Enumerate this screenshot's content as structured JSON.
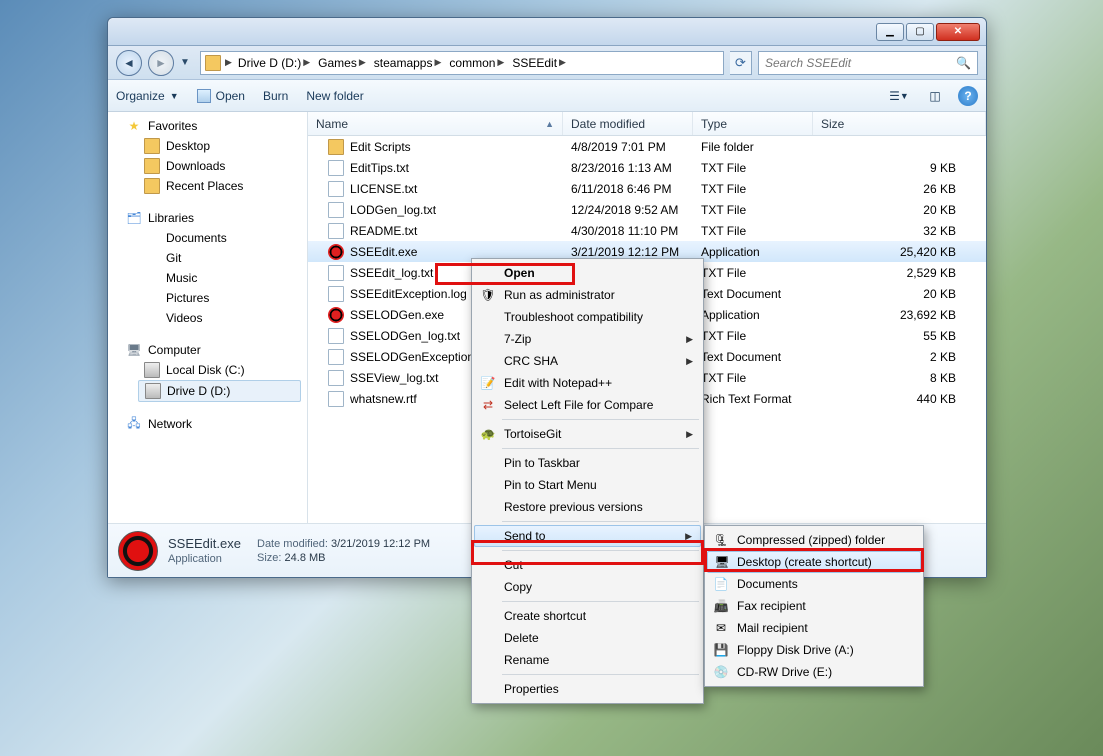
{
  "address": {
    "segments": [
      "Drive D (D:)",
      "Games",
      "steamapps",
      "common",
      "SSEEdit"
    ]
  },
  "search": {
    "placeholder": "Search SSEEdit"
  },
  "toolbar": {
    "organize": "Organize",
    "open": "Open",
    "burn": "Burn",
    "newfolder": "New folder"
  },
  "columns": {
    "name": "Name",
    "date": "Date modified",
    "type": "Type",
    "size": "Size"
  },
  "nav": {
    "favorites": {
      "label": "Favorites",
      "items": [
        "Desktop",
        "Downloads",
        "Recent Places"
      ]
    },
    "libraries": {
      "label": "Libraries",
      "items": [
        "Documents",
        "Git",
        "Music",
        "Pictures",
        "Videos"
      ]
    },
    "computer": {
      "label": "Computer",
      "items": [
        "Local Disk (C:)",
        "Drive D (D:)"
      ],
      "selected": 1
    },
    "network": {
      "label": "Network"
    }
  },
  "files": [
    {
      "name": "Edit Scripts",
      "date": "4/8/2019 7:01 PM",
      "type": "File folder",
      "size": "",
      "ico": "fold"
    },
    {
      "name": "EditTips.txt",
      "date": "8/23/2016 1:13 AM",
      "type": "TXT File",
      "size": "9 KB",
      "ico": "txt"
    },
    {
      "name": "LICENSE.txt",
      "date": "6/11/2018 6:46 PM",
      "type": "TXT File",
      "size": "26 KB",
      "ico": "txt"
    },
    {
      "name": "LODGen_log.txt",
      "date": "12/24/2018 9:52 AM",
      "type": "TXT File",
      "size": "20 KB",
      "ico": "txt"
    },
    {
      "name": "README.txt",
      "date": "4/30/2018 11:10 PM",
      "type": "TXT File",
      "size": "32 KB",
      "ico": "txt"
    },
    {
      "name": "SSEEdit.exe",
      "date": "3/21/2019 12:12 PM",
      "type": "Application",
      "size": "25,420 KB",
      "ico": "exe",
      "selected": true
    },
    {
      "name": "SSEEdit_log.txt",
      "date": "",
      "type": "TXT File",
      "size": "2,529 KB",
      "ico": "txt"
    },
    {
      "name": "SSEEditException.log",
      "date": "",
      "type": "Text Document",
      "size": "20 KB",
      "ico": "txt"
    },
    {
      "name": "SSELODGen.exe",
      "date": "",
      "type": "Application",
      "size": "23,692 KB",
      "ico": "exe"
    },
    {
      "name": "SSELODGen_log.txt",
      "date": "",
      "type": "TXT File",
      "size": "55 KB",
      "ico": "txt"
    },
    {
      "name": "SSELODGenException.log",
      "date": "",
      "type": "Text Document",
      "size": "2 KB",
      "ico": "txt"
    },
    {
      "name": "SSEView_log.txt",
      "date": "",
      "type": "TXT File",
      "size": "8 KB",
      "ico": "txt"
    },
    {
      "name": "whatsnew.rtf",
      "date": "",
      "type": "Rich Text Format",
      "size": "440 KB",
      "ico": "txt"
    }
  ],
  "details": {
    "name": "SSEEdit.exe",
    "type": "Application",
    "mod_label": "Date modified:",
    "mod": "3/21/2019 12:12 PM",
    "size_label": "Size:",
    "size": "24.8 MB"
  },
  "ctx": {
    "open": "Open",
    "runas": "Run as administrator",
    "trouble": "Troubleshoot compatibility",
    "sevenzip": "7-Zip",
    "crcsha": "CRC SHA",
    "notepad": "Edit with Notepad++",
    "beyondcmp": "Select Left File for Compare",
    "tortoise": "TortoiseGit",
    "pintask": "Pin to Taskbar",
    "pinstart": "Pin to Start Menu",
    "restore": "Restore previous versions",
    "sendto": "Send to",
    "cut": "Cut",
    "copy": "Copy",
    "shortcut": "Create shortcut",
    "delete": "Delete",
    "rename": "Rename",
    "props": "Properties"
  },
  "sendto": {
    "zip": "Compressed (zipped) folder",
    "desktop": "Desktop (create shortcut)",
    "docs": "Documents",
    "fax": "Fax recipient",
    "mail": "Mail recipient",
    "floppy": "Floppy Disk Drive (A:)",
    "cdrw": "CD-RW Drive (E:)"
  }
}
